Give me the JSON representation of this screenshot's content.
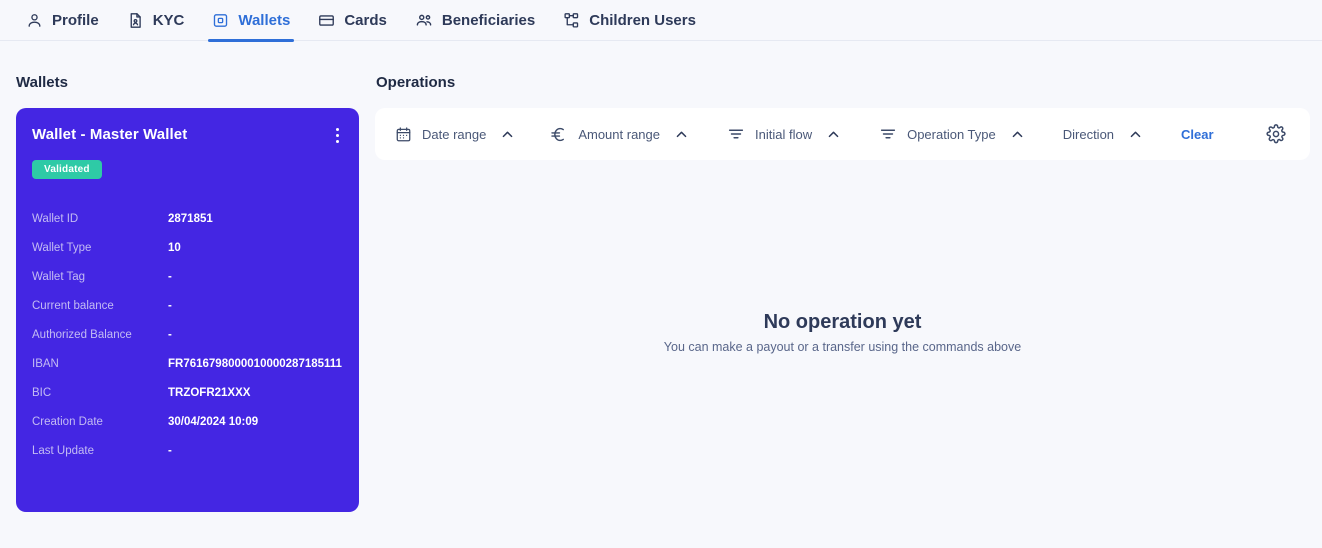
{
  "tabs": [
    {
      "label": "Profile",
      "icon": "user-icon",
      "active": false
    },
    {
      "label": "KYC",
      "icon": "document-icon",
      "active": false
    },
    {
      "label": "Wallets",
      "icon": "wallet-icon",
      "active": true
    },
    {
      "label": "Cards",
      "icon": "card-icon",
      "active": false
    },
    {
      "label": "Beneficiaries",
      "icon": "users-icon",
      "active": false
    },
    {
      "label": "Children Users",
      "icon": "hierarchy-icon",
      "active": false
    }
  ],
  "left": {
    "section_title": "Wallets",
    "card": {
      "title": "Wallet - Master Wallet",
      "menu_icon": "kebab-menu-icon",
      "status_badge": "Validated",
      "rows": [
        {
          "key": "Wallet ID",
          "value": "2871851"
        },
        {
          "key": "Wallet Type",
          "value": "10"
        },
        {
          "key": "Wallet Tag",
          "value": "-"
        },
        {
          "key": "Current balance",
          "value": "-"
        },
        {
          "key": "Authorized Balance",
          "value": "-"
        },
        {
          "key": "IBAN",
          "value": "FR7616798000010000287185111"
        },
        {
          "key": "BIC",
          "value": "TRZOFR21XXX"
        },
        {
          "key": "Creation Date",
          "value": "30/04/2024 10:09"
        },
        {
          "key": "Last Update",
          "value": "-"
        }
      ]
    }
  },
  "right": {
    "section_title": "Operations",
    "filters": [
      {
        "label": "Date range",
        "icon": "calendar-icon",
        "chevron": "chevron-up-icon"
      },
      {
        "label": "Amount range",
        "icon": "euro-icon",
        "chevron": "chevron-up-icon"
      },
      {
        "label": "Initial flow",
        "icon": "filter-lines-icon",
        "chevron": "chevron-up-icon"
      },
      {
        "label": "Operation Type",
        "icon": "filter-lines-icon",
        "chevron": "chevron-up-icon"
      },
      {
        "label": "Direction",
        "icon": "none",
        "chevron": "chevron-up-icon"
      }
    ],
    "clear_label": "Clear",
    "settings_icon": "gear-icon",
    "empty_state": {
      "title": "No operation yet",
      "subtitle": "You can make a payout or a transfer using the commands above"
    }
  },
  "colors": {
    "page_bg": "#f7f8fc",
    "card_purple": "#4426e3",
    "badge_green": "#2ecaa6",
    "accent_blue": "#2f6fd8",
    "label_lavender": "#c3bbf3",
    "text_dark": "#2e3a59"
  }
}
